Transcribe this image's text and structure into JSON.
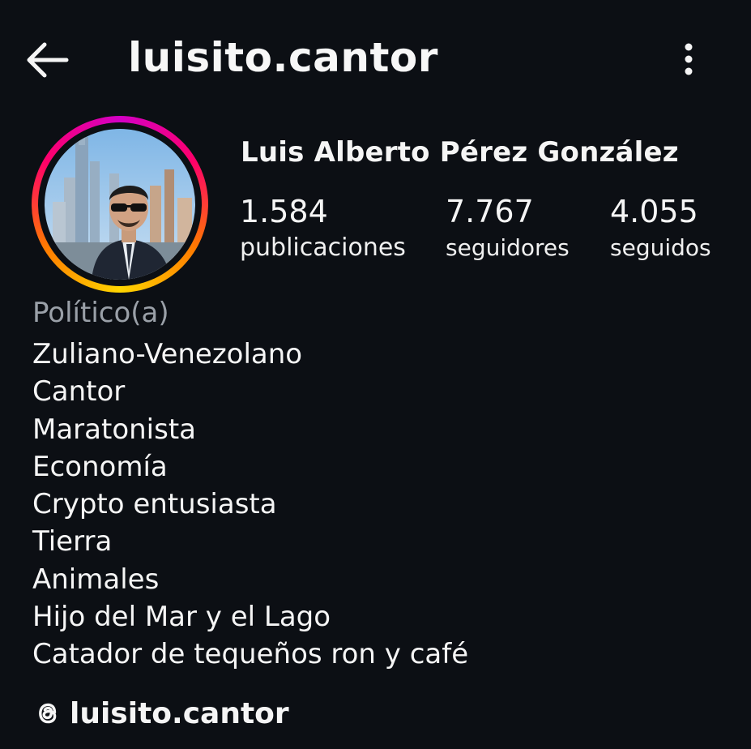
{
  "header": {
    "back_icon": "arrow-left-icon",
    "username": "luisito.cantor",
    "more_icon": "vertical-ellipsis-icon"
  },
  "profile": {
    "avatar_icon": "profile-photo",
    "story_ring_colors": [
      "#d300c5",
      "#ff0069",
      "#ff7a00",
      "#ffd600"
    ],
    "full_name": "Luis Alberto Pérez González",
    "stats": {
      "posts": {
        "value": "1.584",
        "label": "publicaciones"
      },
      "followers": {
        "value": "7.767",
        "label": "seguidores"
      },
      "following": {
        "value": "4.055",
        "label": "seguidos"
      }
    },
    "category": "Político(a)",
    "bio_lines": [
      "Zuliano-Venezolano",
      "Cantor",
      "Maratonista",
      "Economía",
      "Crypto entusiasta",
      "Tierra",
      "Animales",
      "Hijo del Mar y el Lago",
      "Catador de tequeños ron y café"
    ],
    "threads": {
      "icon": "threads-icon",
      "handle": "luisito.cantor"
    }
  },
  "colors": {
    "background": "#0c0f14",
    "text": "#f5f5f5",
    "muted_text": "#9aa0a8"
  }
}
